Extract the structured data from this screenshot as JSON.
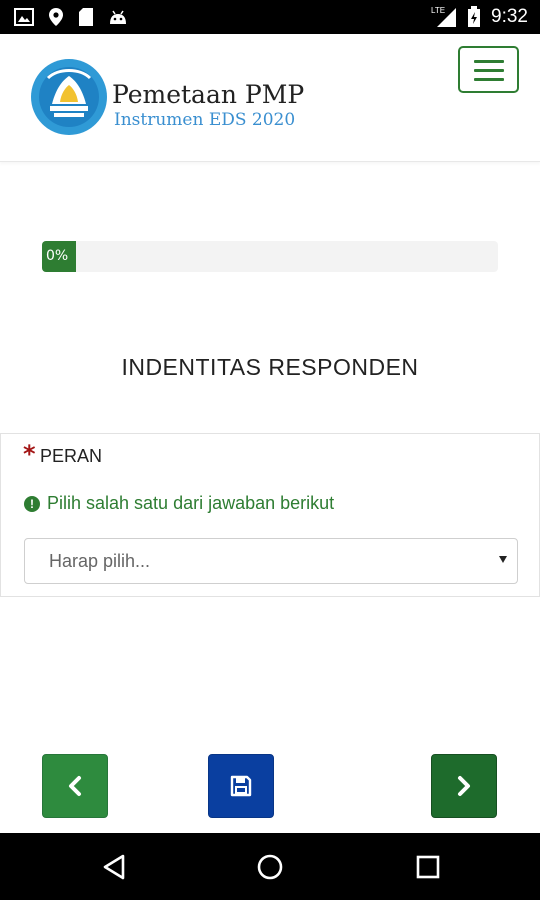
{
  "status_bar": {
    "time": "9:32",
    "network": "LTE",
    "icons_left": [
      "image-icon",
      "location-pin-icon",
      "sd-card-icon",
      "android-icon"
    ],
    "icons_right": [
      "signal-icon",
      "battery-icon"
    ]
  },
  "header": {
    "title": "Pemetaan PMP",
    "subtitle": "Instrumen EDS 2020",
    "menu_icon": "hamburger-icon"
  },
  "progress": {
    "value": 0,
    "label": "0%"
  },
  "section": {
    "title": "INDENTITAS RESPONDEN"
  },
  "question": {
    "required_mark": "*",
    "label": "PERAN",
    "hint": "Pilih salah satu dari jawaban berikut",
    "hint_icon": "exclamation-circle-icon",
    "select_placeholder": "Harap pilih..."
  },
  "buttons": {
    "prev_icon": "chevron-left-icon",
    "save_icon": "floppy-disk-icon",
    "next_icon": "chevron-right-icon"
  },
  "android_nav": {
    "back_icon": "triangle-back-icon",
    "home_icon": "circle-home-icon",
    "recents_icon": "square-recents-icon"
  },
  "colors": {
    "primary_green": "#2e7d32",
    "dark_green": "#1e6b2c",
    "save_blue": "#0a3fa0",
    "subtitle_blue": "#3a8fd0",
    "required_red": "#a31515"
  }
}
